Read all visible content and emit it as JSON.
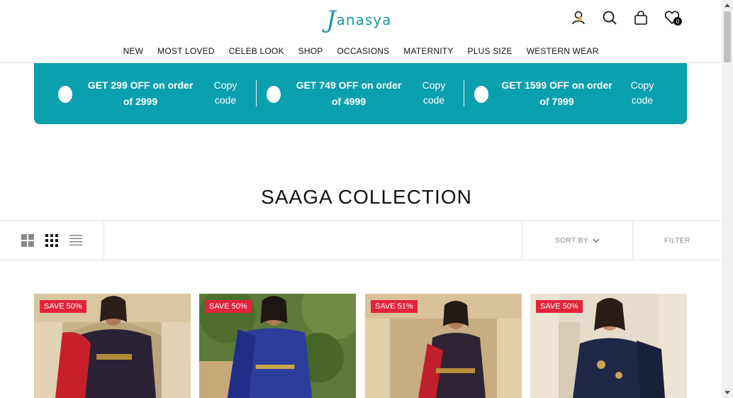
{
  "brand": {
    "logo_first": "J",
    "logo_rest": "anasya"
  },
  "header": {
    "wishlist_count": "0"
  },
  "nav": [
    "NEW",
    "MOST LOVED",
    "CELEB LOOK",
    "SHOP",
    "OCCASIONS",
    "MATERNITY",
    "PLUS SIZE",
    "WESTERN WEAR"
  ],
  "offers": [
    {
      "line1": "GET 299 OFF on order",
      "line2": "of 2999",
      "copy1": "Copy",
      "copy2": "code"
    },
    {
      "line1": "GET 749 OFF on order",
      "line2": "of 4999",
      "copy1": "Copy",
      "copy2": "code"
    },
    {
      "line1": "GET 1599 OFF on order",
      "line2": "of 7999",
      "copy1": "Copy",
      "copy2": "code"
    }
  ],
  "collection": {
    "title": "SAAGA COLLECTION"
  },
  "toolbar": {
    "sort_label": "SORT BY",
    "filter_label": "FILTER"
  },
  "products": [
    {
      "badge": "SAVE 50%"
    },
    {
      "badge": "SAVE 50%"
    },
    {
      "badge": "SAVE 51%"
    },
    {
      "badge": "SAVE 50%"
    }
  ],
  "colors": {
    "accent": "#0aa0ae",
    "logo": "#1a9aa6",
    "sale_badge": "#e2233a"
  },
  "icons": [
    "user-icon",
    "search-icon",
    "bag-icon",
    "heart-icon",
    "grid-large-icon",
    "grid-small-icon",
    "list-icon",
    "chevron-down-icon"
  ]
}
